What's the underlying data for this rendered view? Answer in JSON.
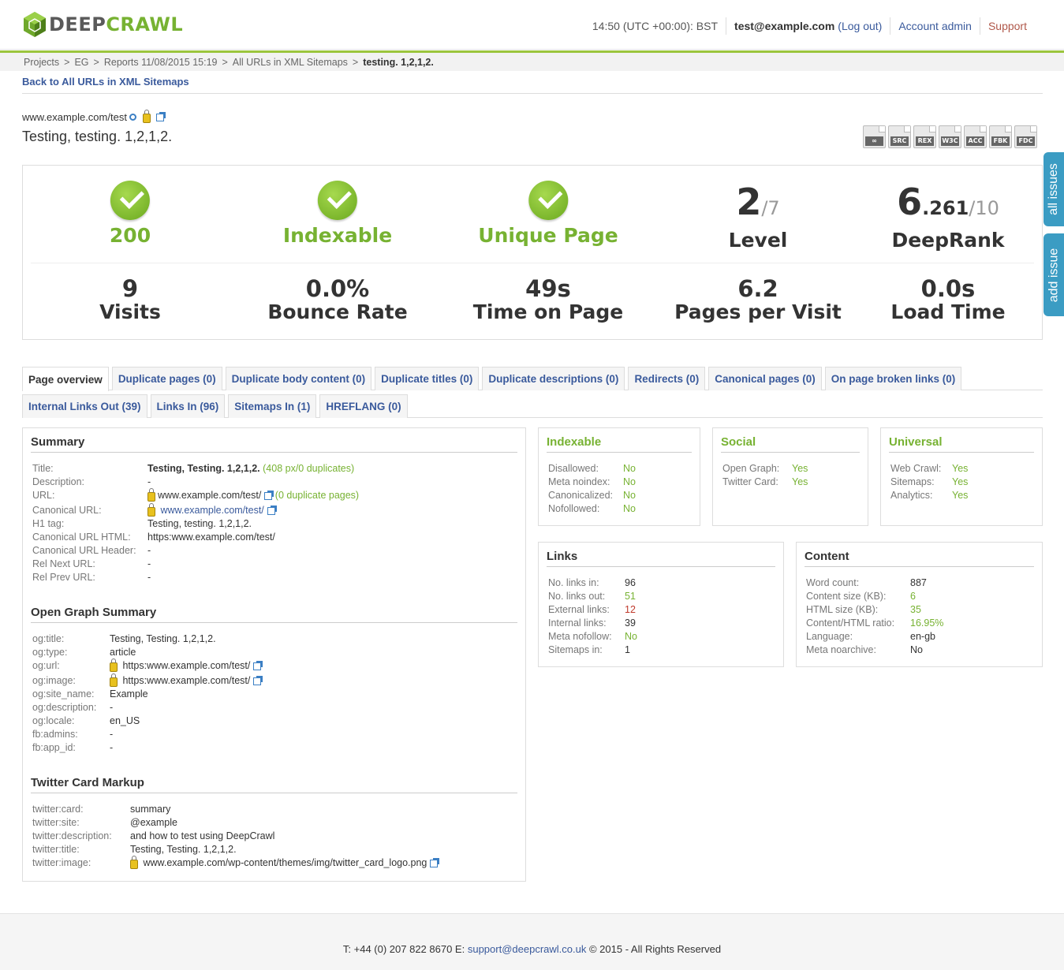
{
  "header": {
    "logo_deep": "DEEP",
    "logo_crawl": "CRAWL",
    "time": "14:50 (UTC +00:00): BST",
    "email": "test@example.com",
    "logout": "(Log out)",
    "account_admin": "Account admin",
    "support": "Support"
  },
  "breadcrumb": {
    "items": [
      "Projects",
      "EG",
      "Reports 11/08/2015 15:19",
      "All URLs in XML Sitemaps"
    ],
    "separator": ">",
    "current": "testing. 1,2,1,2."
  },
  "back_link": "Back to All URLs in XML Sitemaps",
  "page": {
    "url": "www.example.com/test",
    "title": "Testing, testing. 1,2,1,2."
  },
  "tool_icons": [
    "SRC",
    "REX",
    "W3C",
    "ACC",
    "FBK",
    "FDC"
  ],
  "side_tabs": {
    "all_issues": "all issues",
    "add_issue": "add issue"
  },
  "stats": {
    "status": "200",
    "indexable": "Indexable",
    "unique": "Unique Page",
    "level_value": "2",
    "level_max": "/7",
    "level_label": "Level",
    "deeprank_int": "6",
    "deeprank_dec": ".261",
    "deeprank_max": "/10",
    "deeprank_label": "DeepRank",
    "visits": "9",
    "visits_label": "Visits",
    "bounce": "0.0%",
    "bounce_label": "Bounce Rate",
    "time_on_page": "49s",
    "time_on_page_label": "Time on Page",
    "ppv": "6.2",
    "ppv_label": "Pages per Visit",
    "load": "0.0s",
    "load_label": "Load Time"
  },
  "tabs_row1": [
    "Page overview",
    "Duplicate pages (0)",
    "Duplicate body content (0)",
    "Duplicate titles (0)",
    "Duplicate descriptions (0)",
    "Redirects (0)",
    "Canonical pages (0)",
    "On page broken links (0)"
  ],
  "tabs_row2": [
    "Internal Links Out (39)",
    "Links In (96)",
    "Sitemaps In (1)",
    "HREFLANG (0)"
  ],
  "summary": {
    "heading": "Summary",
    "title_k": "Title:",
    "title_v": "Testing, Testing. 1,2,1,2.",
    "title_px": "(408 px/0 duplicates)",
    "desc_k": "Description:",
    "desc_v": "-",
    "url_k": "URL:",
    "url_v": "www.example.com/test/",
    "url_dup": "(0 duplicate pages)",
    "canon_k": "Canonical URL:",
    "canon_v": "www.example.com/test/",
    "h1_k": "H1 tag:",
    "h1_v": "Testing, testing. 1,2,1,2.",
    "canon_html_k": "Canonical URL HTML:",
    "canon_html_v": "https:www.example.com/test/",
    "canon_hdr_k": "Canonical URL Header:",
    "canon_hdr_v": "-",
    "next_k": "Rel Next URL:",
    "next_v": "-",
    "prev_k": "Rel Prev URL:",
    "prev_v": "-"
  },
  "og": {
    "heading": "Open Graph Summary",
    "rows": [
      {
        "k": "og:title:",
        "v": "Testing, Testing. 1,2,1,2."
      },
      {
        "k": "og:type:",
        "v": "article"
      },
      {
        "k": "og:url:",
        "v": "https:www.example.com/test/"
      },
      {
        "k": "og:image:",
        "v": "https:www.example.com/test/"
      },
      {
        "k": "og:site_name:",
        "v": "Example"
      },
      {
        "k": "og:description:",
        "v": "-"
      },
      {
        "k": "og:locale:",
        "v": "en_US"
      },
      {
        "k": "fb:admins:",
        "v": "-"
      },
      {
        "k": "fb:app_id:",
        "v": "-"
      }
    ]
  },
  "twitter": {
    "heading": "Twitter Card Markup",
    "rows": [
      {
        "k": "twitter:card:",
        "v": "summary"
      },
      {
        "k": "twitter:site:",
        "v": "@example"
      },
      {
        "k": "twitter:description:",
        "v": "and how to test using DeepCrawl"
      },
      {
        "k": "twitter:title:",
        "v": "Testing, Testing. 1,2,1,2."
      },
      {
        "k": "twitter:image:",
        "v": "www.example.com/wp-content/themes/img/twitter_card_logo.png"
      }
    ]
  },
  "indexable_panel": {
    "heading": "Indexable",
    "rows": [
      {
        "k": "Disallowed:",
        "v": "No"
      },
      {
        "k": "Meta noindex:",
        "v": "No"
      },
      {
        "k": "Canonicalized:",
        "v": "No"
      },
      {
        "k": "Nofollowed:",
        "v": "No"
      }
    ]
  },
  "social_panel": {
    "heading": "Social",
    "rows": [
      {
        "k": "Open Graph:",
        "v": "Yes"
      },
      {
        "k": "Twitter Card:",
        "v": "Yes"
      }
    ]
  },
  "universal_panel": {
    "heading": "Universal",
    "rows": [
      {
        "k": "Web Crawl:",
        "v": "Yes"
      },
      {
        "k": "Sitemaps:",
        "v": "Yes"
      },
      {
        "k": "Analytics:",
        "v": "Yes"
      }
    ]
  },
  "links_panel": {
    "heading": "Links",
    "rows": [
      {
        "k": "No. links in:",
        "v": "96"
      },
      {
        "k": "No. links out:",
        "v": "51"
      },
      {
        "k": "External links:",
        "v": "12"
      },
      {
        "k": "Internal links:",
        "v": "39"
      },
      {
        "k": "Meta nofollow:",
        "v": "No"
      },
      {
        "k": "Sitemaps in:",
        "v": "1"
      }
    ]
  },
  "content_panel": {
    "heading": "Content",
    "rows": [
      {
        "k": "Word count:",
        "v": "887"
      },
      {
        "k": "Content size (KB):",
        "v": "6"
      },
      {
        "k": "HTML size (KB):",
        "v": "35"
      },
      {
        "k": "Content/HTML ratio:",
        "v": "16.95%"
      },
      {
        "k": "Language:",
        "v": "en-gb"
      },
      {
        "k": "Meta noarchive:",
        "v": "No"
      }
    ]
  },
  "footer": {
    "phone": "T: +44 (0) 207 822 8670 E:",
    "email": "support@deepcrawl.co.uk",
    "copy": "© 2015 - All Rights Reserved"
  },
  "colors": {
    "accent_green": "#77b232",
    "link_blue": "#3a5a9c",
    "side_tab": "#3b9cc3",
    "bar_green": "#9bc53d"
  }
}
